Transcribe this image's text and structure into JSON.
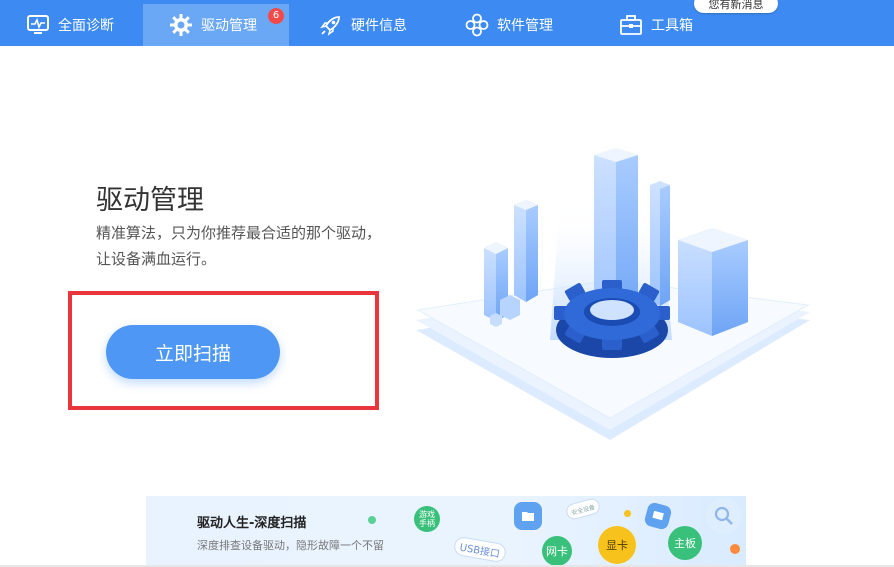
{
  "nav": {
    "items": [
      {
        "label": "全面诊断",
        "icon": "monitor-icon"
      },
      {
        "label": "驱动管理",
        "icon": "gear-icon",
        "badge": "6",
        "active": true
      },
      {
        "label": "硬件信息",
        "icon": "rocket-icon"
      },
      {
        "label": "软件管理",
        "icon": "flower-apps-icon"
      },
      {
        "label": "工具箱",
        "icon": "toolbox-icon"
      }
    ],
    "message_bubble": "您有新消息"
  },
  "hero": {
    "title": "驱动管理",
    "desc_line1": "精准算法，只为你推荐最合适的那个驱动，",
    "desc_line2": "让设备满血运行。",
    "scan_button": "立即扫描",
    "highlight_color": "#e8363c"
  },
  "banner": {
    "title": "驱动人生-深度扫描",
    "subtitle": "深度排查设备驱动，隐形故障一个不留",
    "tags": {
      "game": "游戏\n手柄",
      "usb": "USB接口",
      "network": "网卡",
      "gpu": "显卡",
      "motherboard": "主板",
      "safe": "安全设备"
    }
  },
  "colors": {
    "nav_bg": "#3d8bf2",
    "nav_active": "#6aa8f6",
    "button": "#4f97f4",
    "badge": "#f24a4a"
  }
}
